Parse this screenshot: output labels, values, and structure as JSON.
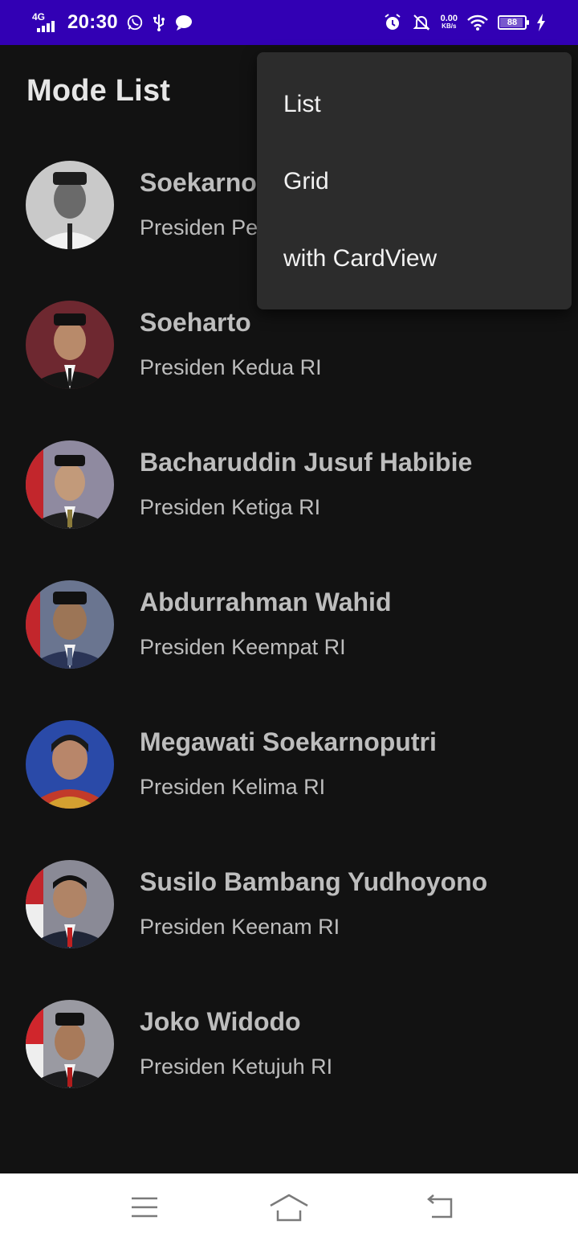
{
  "status_bar": {
    "network": "4G",
    "time": "20:30",
    "speed_value": "0.00",
    "speed_unit": "KB/s",
    "battery": "88",
    "battery_level": 0.88,
    "bg_color": "#3200b4",
    "icons": [
      "signal-icon",
      "whatsapp-icon",
      "usb-icon",
      "chat-bubble-icon",
      "alarm-icon",
      "bell-off-icon",
      "wifi-icon",
      "battery-icon",
      "charging-bolt-icon"
    ]
  },
  "app_bar": {
    "title": "Mode List"
  },
  "overflow_menu": {
    "items": [
      {
        "label": "List"
      },
      {
        "label": "Grid"
      },
      {
        "label": "with CardView"
      }
    ]
  },
  "heroes": [
    {
      "name": "Soekarno",
      "description": "Presiden Pertama RI"
    },
    {
      "name": "Soeharto",
      "description": "Presiden Kedua RI"
    },
    {
      "name": "Bacharuddin Jusuf Habibie",
      "description": "Presiden Ketiga RI"
    },
    {
      "name": "Abdurrahman Wahid",
      "description": "Presiden Keempat RI"
    },
    {
      "name": "Megawati Soekarnoputri",
      "description": "Presiden Kelima RI"
    },
    {
      "name": "Susilo Bambang Yudhoyono",
      "description": "Presiden Keenam RI"
    },
    {
      "name": "Joko Widodo",
      "description": "Presiden Ketujuh RI"
    }
  ],
  "nav_bar": {
    "icons": [
      "menu-icon",
      "home-icon",
      "back-icon"
    ]
  }
}
